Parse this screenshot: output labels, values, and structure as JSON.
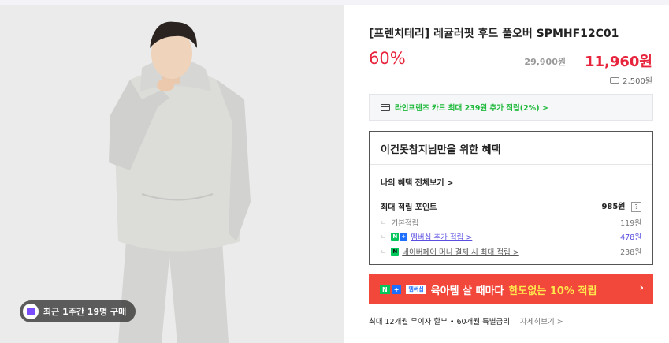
{
  "badge": {
    "recent_purchase": "최근 1주간 19명 구매",
    "icon": "shopping-bag-icon"
  },
  "product": {
    "title": "[프렌치테리] 레귤러핏 후드 풀오버 SPMHF12C01",
    "discount": "60%",
    "original_price": "29,900원",
    "sale_price": "11,960원",
    "shipping_fee": "2,500원"
  },
  "card": {
    "text": "라인프렌즈 카드 최대 239원 추가 적립(2%) >"
  },
  "benefit": {
    "heading": "이건못참지님만을 위한 혜택",
    "see_all": "나의 혜택 전체보기 >",
    "max_label": "최대 적립 포인트",
    "max_value": "985원",
    "help": "?",
    "rows": [
      {
        "label": "기본적립",
        "value": "119원"
      },
      {
        "label": "멤버십 추가 적립 >",
        "value": "478원"
      },
      {
        "label": "네이버페이 머니 결제 시 최대 적립 >",
        "value": "238원"
      }
    ]
  },
  "promo": {
    "tag_n": "N",
    "tag_plus": "+",
    "tag_membership": "멤버십",
    "text_white": "육아템 살 때마다",
    "text_yellow": "한도없는 10% 적립",
    "arrow": "›"
  },
  "install": {
    "text": "최대 12개월 무이자 할부 • 60개월 특별금리",
    "more": "자세히보기 >"
  },
  "colors": {
    "accent_red": "#e8243c",
    "naver_green": "#03c75a",
    "promo_bg": "#f2483b",
    "link_purple": "#5a4fe0"
  }
}
